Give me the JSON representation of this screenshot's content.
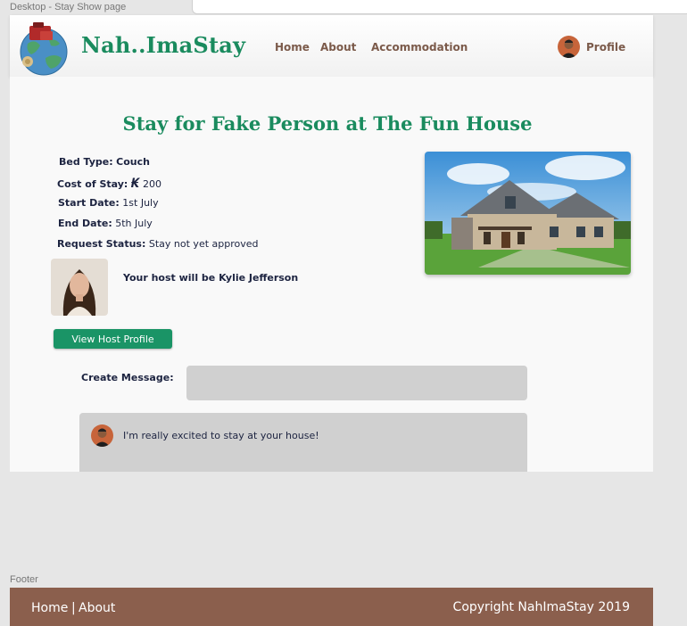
{
  "frame": {
    "desktop_label": "Desktop - Stay Show page",
    "footer_label": "Footer"
  },
  "header": {
    "brand": "Nah..ImaStay",
    "nav": {
      "home": "Home",
      "about": "About",
      "accommodation": "Accommodation",
      "profile": "Profile"
    }
  },
  "stay": {
    "title": "Stay for Fake Person at The Fun House",
    "bed_type": {
      "label": "Bed Type:",
      "value": "Couch"
    },
    "cost": {
      "label": "Cost of Stay:",
      "currency_symbol": "₭",
      "value": "200"
    },
    "start_date": {
      "label": "Start Date:",
      "value": "1st July"
    },
    "end_date": {
      "label": "End Date:",
      "value": "5th July"
    },
    "status": {
      "label": "Request Status:",
      "value": "Stay not yet approved"
    },
    "host_line": "Your host will be Kylie Jefferson",
    "view_host_button": "View Host Profile"
  },
  "message": {
    "label": "Create Message:",
    "input_value": "",
    "messages": [
      {
        "text": "I'm really excited to stay at your house!"
      }
    ]
  },
  "footer": {
    "home": "Home",
    "separator": "|",
    "about": "About",
    "copyright": "Copyright NahImaStay 2019"
  },
  "colors": {
    "brand_green": "#1a8b5e",
    "button_green": "#1a9466",
    "nav_brown": "#7b5a4a",
    "footer_brown": "#8b5f4d"
  },
  "icons": [
    "globe-logo-icon",
    "profile-avatar",
    "house-photo",
    "host-photo",
    "message-avatar"
  ]
}
